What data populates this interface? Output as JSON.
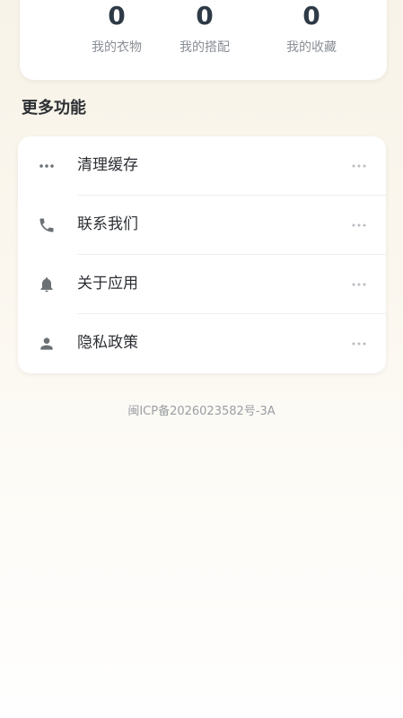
{
  "stats": [
    {
      "value": "0",
      "label": "我的衣物"
    },
    {
      "value": "0",
      "label": "我的搭配"
    },
    {
      "value": "0",
      "label": "我的收藏"
    }
  ],
  "more_section": {
    "title": "更多功能",
    "items": [
      {
        "label": "清理缓存",
        "icon": "more-horizontal-icon"
      },
      {
        "label": "联系我们",
        "icon": "phone-icon"
      },
      {
        "label": "关于应用",
        "icon": "bell-icon"
      },
      {
        "label": "隐私政策",
        "icon": "person-icon"
      }
    ]
  },
  "footer": {
    "icp": "闽ICP备2026023582号-3A"
  },
  "colors": {
    "icon": "#6b7075",
    "more": "#b8bcc0",
    "value": "#2e3a46"
  }
}
